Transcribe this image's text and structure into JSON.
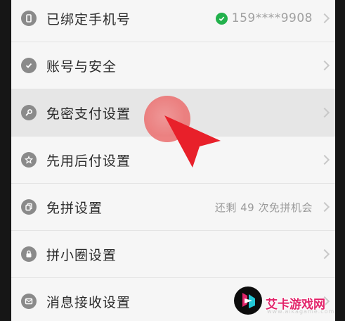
{
  "settings": {
    "items": [
      {
        "label": "已绑定手机号",
        "value": "159****9908",
        "icon": "phone-icon"
      },
      {
        "label": "账号与安全",
        "value": "",
        "icon": "shield-check-icon"
      },
      {
        "label": "免密支付设置",
        "value": "",
        "icon": "key-icon"
      },
      {
        "label": "先用后付设置",
        "value": "",
        "icon": "badge-star-icon"
      },
      {
        "label": "免拼设置",
        "value": "还剩 49 次免拼机会",
        "icon": "copy-icon"
      },
      {
        "label": "拼小圈设置",
        "value": "",
        "icon": "lock-icon"
      },
      {
        "label": "消息接收设置",
        "value": "",
        "icon": "message-icon"
      }
    ]
  },
  "watermark": {
    "text": "艾卡游戏网",
    "sub": "www.aikagame.com"
  },
  "colors": {
    "accent_red": "#e8202a",
    "verified_green": "#22b14c",
    "watermark_pink": "#e2246a"
  }
}
